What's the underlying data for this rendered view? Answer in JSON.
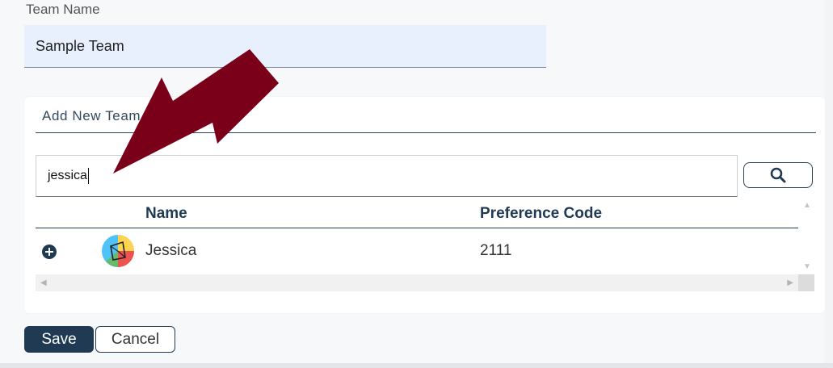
{
  "team": {
    "label": "Team Name",
    "value": "Sample Team"
  },
  "add_members": {
    "title": "Add New Team Members",
    "search_value": "jessica",
    "search_icon": "search-icon"
  },
  "grid": {
    "columns": [
      "Name",
      "Preference Code"
    ],
    "rows": [
      {
        "name": "Jessica",
        "preference_code": "2111",
        "avatar": "colorful-avatar-icon",
        "action_icon": "add-circle-icon"
      }
    ]
  },
  "actions": {
    "save_label": "Save",
    "cancel_label": "Cancel"
  },
  "colors": {
    "primary": "#1f3a52",
    "input_fill": "#e8f0fe",
    "arrow": "#7a0019"
  }
}
